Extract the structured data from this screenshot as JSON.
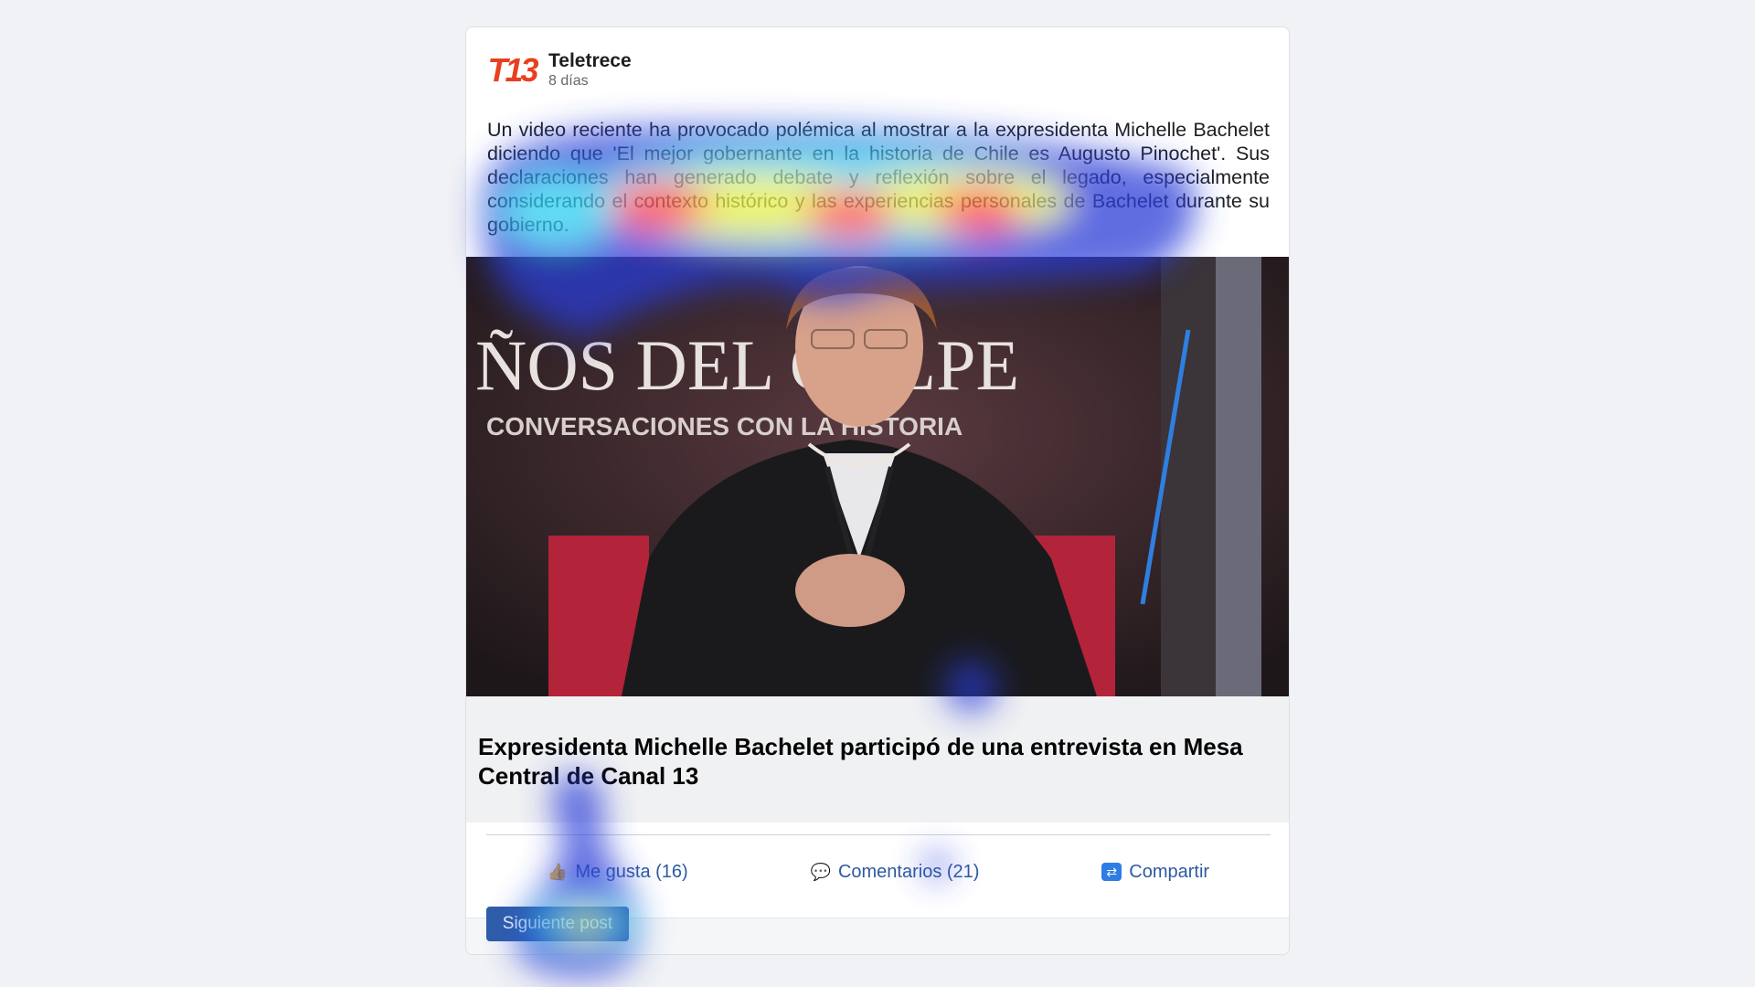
{
  "post": {
    "author": "Teletrece",
    "logo_text": "T13",
    "time": "8 días",
    "text": "Un video reciente ha provocado polémica al mostrar a la expresidenta Michelle Bachelet diciendo que 'El mejor gobernante en la historia de Chile es Augusto Pinochet'. Sus declaraciones han generado debate y reflexión sobre el legado, especialmente considerando el contexto histórico y las experiencias personales de Bachelet durante su gobierno.",
    "image": {
      "banner_line1": "ÑOS DEL GOLPE",
      "banner_line2": "CONVERSACIONES CON LA HISTORIA"
    },
    "link_title": "Expresidenta Michelle Bachelet participó de una entrevista en Mesa Central de Canal 13"
  },
  "actions": {
    "like_label": "Me gusta (16)",
    "comment_label": "Comentarios (21)",
    "share_label": "Compartir",
    "like_icon": "thumbs-up-icon",
    "comment_icon": "speech-bubble-icon",
    "share_icon": "share-icon"
  },
  "footer": {
    "next_label": "Siguiente post"
  },
  "colors": {
    "accent": "#2f5ea8",
    "logo": "#e8401f"
  }
}
